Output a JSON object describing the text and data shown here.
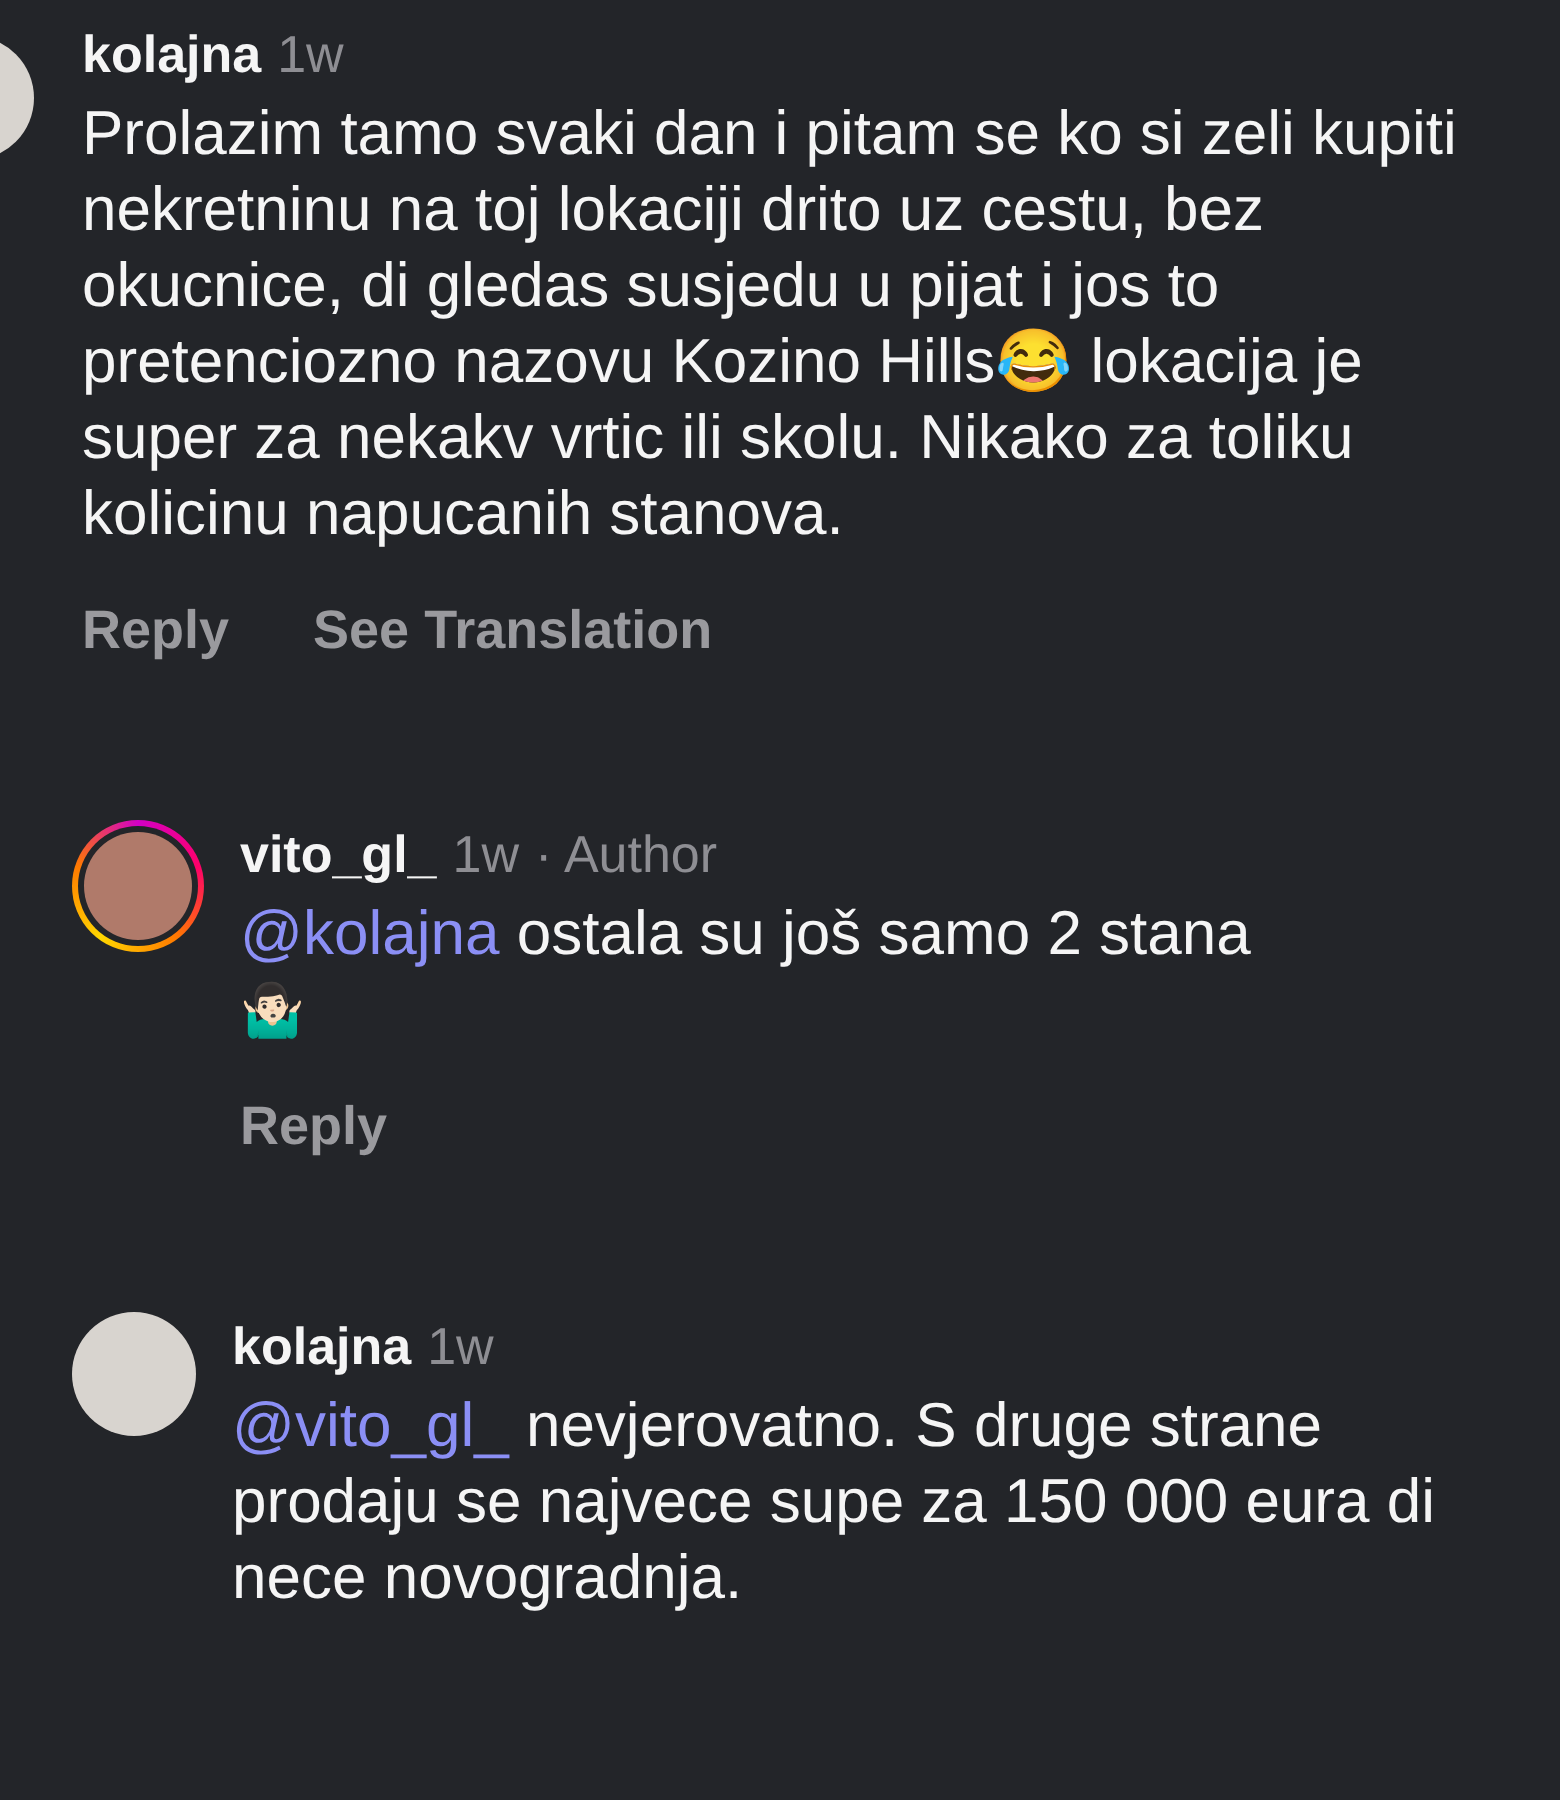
{
  "comments": [
    {
      "username": "kolajna",
      "time": "1w",
      "body": {
        "text": "Prolazim tamo svaki dan i pitam se ko si zeli kupiti nekretninu na toj lokaciji drito uz cestu, bez okucnice, di gledas susjedu u pijat i jos to pretenciozno nazovu Kozino Hills😂 lokacija je super za nekakv vrtic ili skolu. Nikako za toliku kolicinu napucanih stanova."
      },
      "actions": [
        "Reply",
        "See Translation"
      ],
      "children": [
        {
          "username": "vito_gl_",
          "time": "1w",
          "author_label": "· Author",
          "story_ring": true,
          "body": {
            "mention": "@kolajna",
            "text": "ostala su još samo 2 stana",
            "emoji": "🤷🏻‍♂️"
          },
          "actions": [
            "Reply"
          ]
        },
        {
          "username": "kolajna",
          "time": "1w",
          "story_ring": false,
          "body": {
            "mention": "@vito_gl_",
            "text": "nevjerovatno. S druge strane prodaju se najvece supe za 150 000 eura di nece novogradnja."
          }
        }
      ]
    }
  ]
}
